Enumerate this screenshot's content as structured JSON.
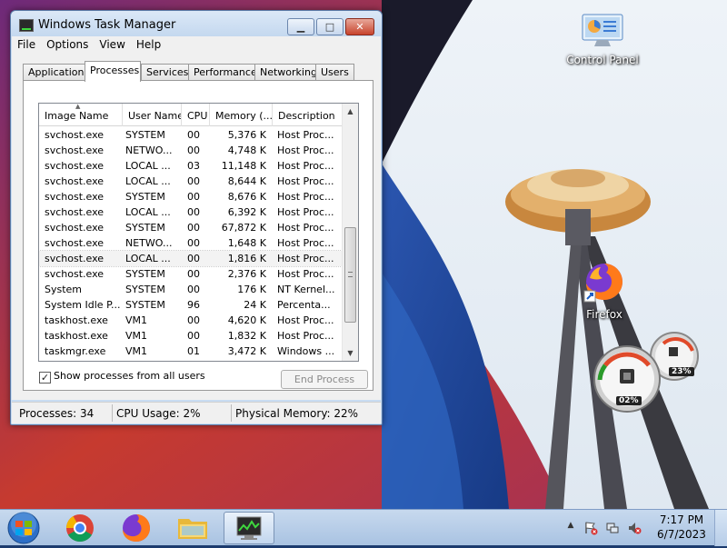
{
  "window": {
    "title": "Windows Task Manager",
    "min_label": "▁",
    "max_label": "□",
    "close_label": "✕"
  },
  "menu": [
    "File",
    "Options",
    "View",
    "Help"
  ],
  "tabs": [
    "Applications",
    "Processes",
    "Services",
    "Performance",
    "Networking",
    "Users"
  ],
  "active_tab": "Processes",
  "columns": [
    "Image Name",
    "User Name",
    "CPU",
    "Memory (...",
    "Description"
  ],
  "processes": [
    {
      "name": "svchost.exe",
      "user": "SYSTEM",
      "cpu": "00",
      "mem": "5,376 K",
      "desc": "Host Proc..."
    },
    {
      "name": "svchost.exe",
      "user": "NETWO...",
      "cpu": "00",
      "mem": "4,748 K",
      "desc": "Host Proc..."
    },
    {
      "name": "svchost.exe",
      "user": "LOCAL ...",
      "cpu": "03",
      "mem": "11,148 K",
      "desc": "Host Proc..."
    },
    {
      "name": "svchost.exe",
      "user": "LOCAL ...",
      "cpu": "00",
      "mem": "8,644 K",
      "desc": "Host Proc..."
    },
    {
      "name": "svchost.exe",
      "user": "SYSTEM",
      "cpu": "00",
      "mem": "8,676 K",
      "desc": "Host Proc..."
    },
    {
      "name": "svchost.exe",
      "user": "LOCAL ...",
      "cpu": "00",
      "mem": "6,392 K",
      "desc": "Host Proc..."
    },
    {
      "name": "svchost.exe",
      "user": "SYSTEM",
      "cpu": "00",
      "mem": "67,872 K",
      "desc": "Host Proc..."
    },
    {
      "name": "svchost.exe",
      "user": "NETWO...",
      "cpu": "00",
      "mem": "1,648 K",
      "desc": "Host Proc..."
    },
    {
      "name": "svchost.exe",
      "user": "LOCAL ...",
      "cpu": "00",
      "mem": "1,816 K",
      "desc": "Host Proc..."
    },
    {
      "name": "svchost.exe",
      "user": "SYSTEM",
      "cpu": "00",
      "mem": "2,376 K",
      "desc": "Host Proc..."
    },
    {
      "name": "System",
      "user": "SYSTEM",
      "cpu": "00",
      "mem": "176 K",
      "desc": "NT Kernel..."
    },
    {
      "name": "System Idle P...",
      "user": "SYSTEM",
      "cpu": "96",
      "mem": "24 K",
      "desc": "Percenta..."
    },
    {
      "name": "taskhost.exe",
      "user": "VM1",
      "cpu": "00",
      "mem": "4,620 K",
      "desc": "Host Proc..."
    },
    {
      "name": "taskhost.exe",
      "user": "VM1",
      "cpu": "00",
      "mem": "1,832 K",
      "desc": "Host Proc..."
    },
    {
      "name": "taskmgr.exe",
      "user": "VM1",
      "cpu": "01",
      "mem": "3,472 K",
      "desc": "Windows ..."
    }
  ],
  "selected_row": 8,
  "show_all_label": "Show processes from all users",
  "show_all_checked": "✓",
  "end_process_label": "End Process",
  "status": {
    "processes": "Processes: 34",
    "cpu": "CPU Usage: 2%",
    "memory": "Physical Memory: 22%"
  },
  "desktop": {
    "control_panel_label": "Control Panel",
    "firefox_label": "Firefox",
    "gadget_cpu": "02%",
    "gadget_mem": "23%"
  },
  "taskbar": {
    "time": "7:17 PM",
    "date": "6/7/2023",
    "tray_arrow": "▲"
  },
  "colors": {
    "accent": "#3399ff",
    "titlebar": "#c9dcf2",
    "close_button": "#c7432c"
  }
}
